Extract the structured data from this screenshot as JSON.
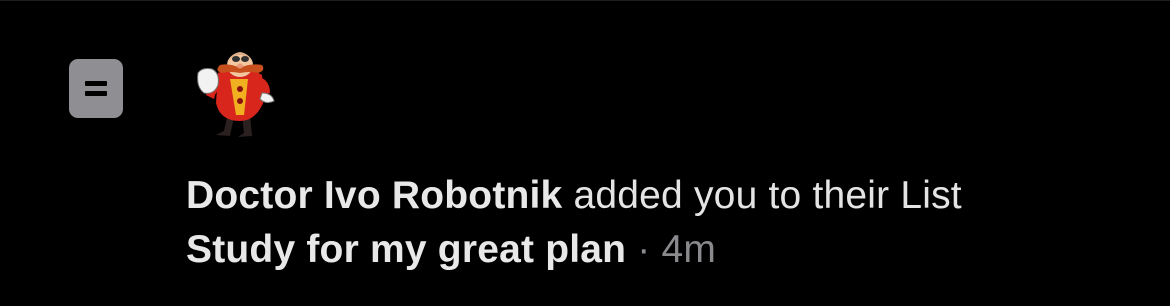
{
  "notification": {
    "list_icon": "list-icon",
    "avatar_icon": "doctor-robotnik-avatar",
    "actor_name": "Doctor Ivo Robotnik",
    "action_text": " added you to their List",
    "list_name": "Study for my great plan",
    "separator": " · ",
    "time_ago": "4m",
    "colors": {
      "background": "#000000",
      "text": "#e6e6e6",
      "muted": "#8a8a8e",
      "icon_bg": "#8e8e93"
    }
  }
}
